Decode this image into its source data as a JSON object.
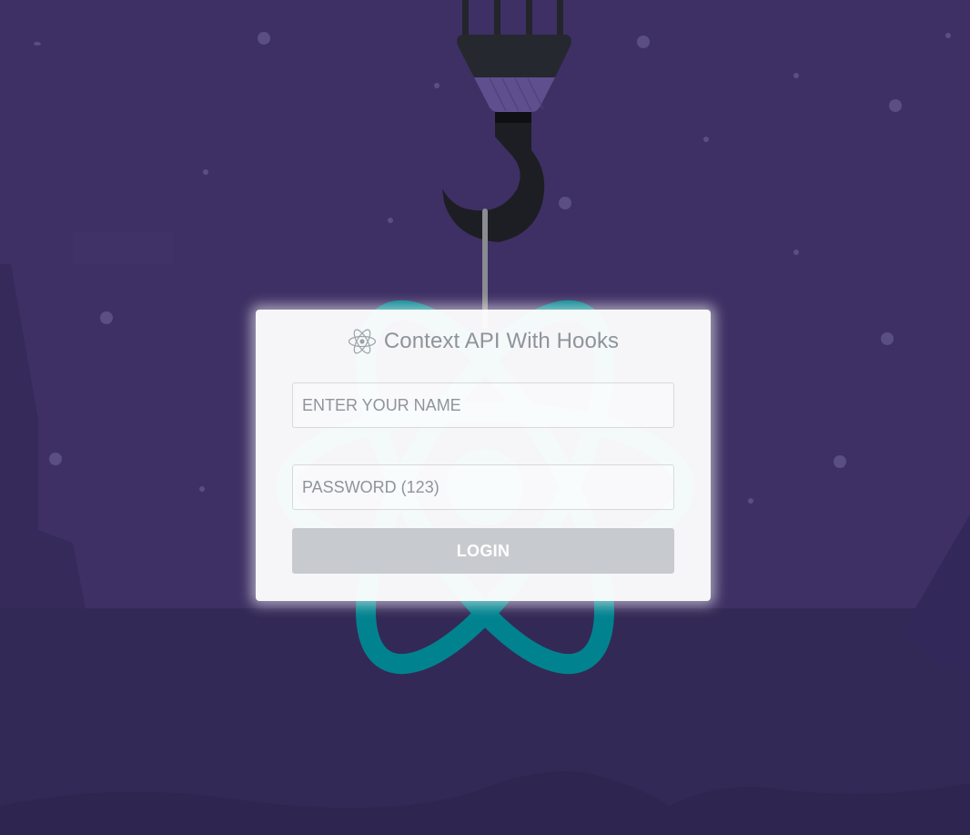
{
  "header": {
    "icon": "react-logo-icon",
    "title": "Context API With Hooks"
  },
  "form": {
    "name_placeholder": "ENTER YOUR NAME",
    "password_placeholder": "PASSWORD (123)",
    "login_label": "LOGIN"
  },
  "background": {
    "illustration": "crane-hook-lifting-react-logo",
    "colors": {
      "sky": "#3e3064",
      "ground": "#332957",
      "react_logo": "#00838f",
      "hook": "#24262c",
      "button": "#c7cbcf"
    }
  }
}
